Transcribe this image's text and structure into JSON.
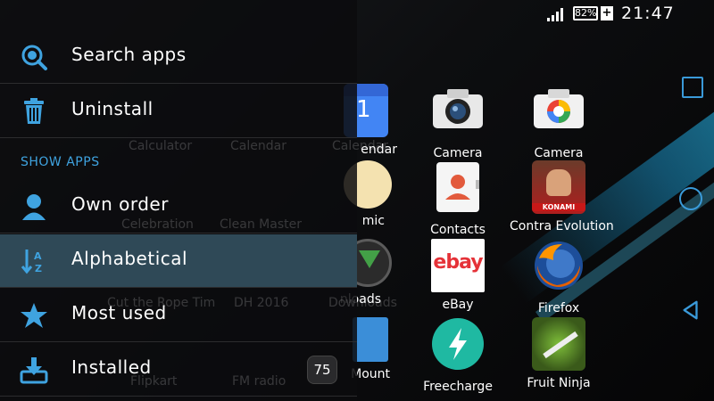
{
  "status_bar": {
    "battery": "82%",
    "time": "21:47"
  },
  "apps": [
    {
      "label": "endar"
    },
    {
      "label": "Camera"
    },
    {
      "label": "Camera"
    },
    {
      "label": "mic"
    },
    {
      "label": "Contacts"
    },
    {
      "label": "Contra Evolution"
    },
    {
      "label": "nloads"
    },
    {
      "label": "eBay"
    },
    {
      "label": "Firefox"
    },
    {
      "label": "Mount"
    },
    {
      "label": "Freecharge"
    },
    {
      "label": "Fruit Ninja"
    }
  ],
  "ghost_apps": [
    {
      "label": "Calculator"
    },
    {
      "label": "Calendar"
    },
    {
      "label": "Calendar"
    },
    {
      "label": "Celebration"
    },
    {
      "label": "Clean Master"
    },
    {
      "label": "Cut the Rope Tim"
    },
    {
      "label": "DH 2016"
    },
    {
      "label": "Downloads"
    },
    {
      "label": "Flipkart"
    },
    {
      "label": "FM radio"
    }
  ],
  "ebay_logo": "ebay",
  "konami_text": "KONAMI",
  "drawer": {
    "search": "Search apps",
    "uninstall": "Uninstall",
    "section": "SHOW APPS",
    "own_order": "Own order",
    "alphabetical": "Alphabetical",
    "most_used": "Most used",
    "installed": "Installed",
    "installed_count": "75"
  },
  "colors": {
    "accent": "#3fa3e0",
    "selected": "#2f4957",
    "drawer_bg": "#0c0c0e"
  },
  "icons": [
    "search-icon",
    "trash-icon",
    "person-icon",
    "sort-az-icon",
    "star-icon",
    "download-icon"
  ]
}
